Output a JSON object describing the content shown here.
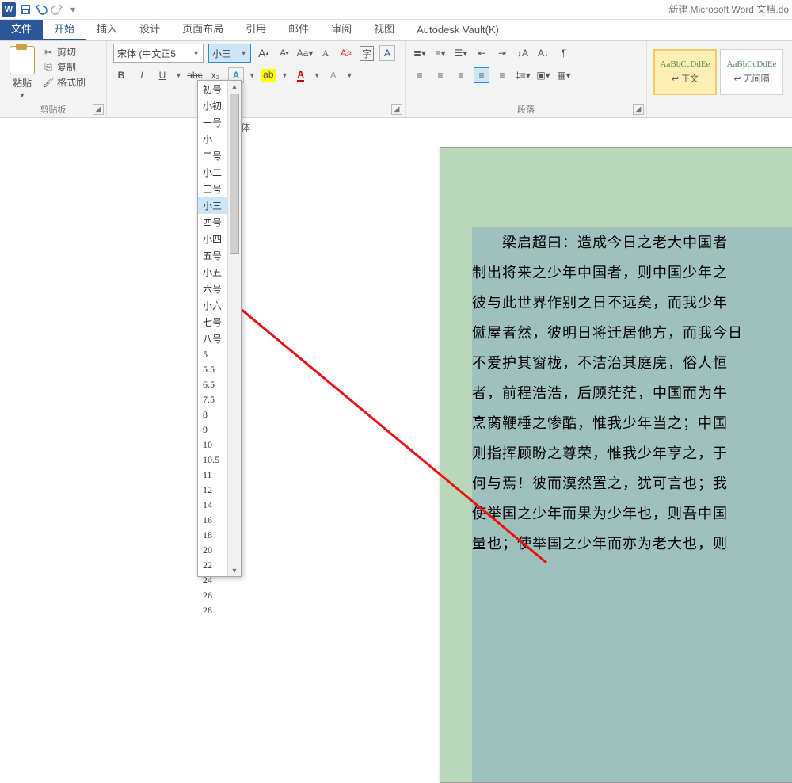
{
  "title": "新建 Microsoft Word 文档.do",
  "qat": {
    "save": "save",
    "undo": "undo",
    "redo": "redo"
  },
  "tabs": {
    "file": "文件",
    "home": "开始",
    "insert": "插入",
    "design": "设计",
    "layout": "页面布局",
    "references": "引用",
    "mailings": "邮件",
    "review": "审阅",
    "view": "视图",
    "vault": "Autodesk Vault(K)"
  },
  "clipboard": {
    "paste": "粘贴",
    "cut": "剪切",
    "copy": "复制",
    "painter": "格式刷",
    "label": "剪贴板"
  },
  "font": {
    "name": "宋体 (中文正5",
    "size": "小三",
    "label_trunc": "体",
    "row_icons": [
      "B",
      "I",
      "U",
      "abc",
      "x₂"
    ]
  },
  "size_list": [
    "初号",
    "小初",
    "一号",
    "小一",
    "二号",
    "小二",
    "三号",
    "小三",
    "四号",
    "小四",
    "五号",
    "小五",
    "六号",
    "小六",
    "七号",
    "八号",
    "5",
    "5.5",
    "6.5",
    "7.5",
    "8",
    "9",
    "10",
    "10.5",
    "11",
    "12",
    "14",
    "16",
    "18",
    "20",
    "22",
    "24",
    "26",
    "28"
  ],
  "size_selected": "小三",
  "paragraph": {
    "label": "段落"
  },
  "styles": {
    "s1": {
      "preview": "AaBbCcDdEe",
      "name": "↩ 正文"
    },
    "s2": {
      "preview": "AaBbCcDdEe",
      "name": "↩ 无间隔"
    }
  },
  "doc_lines": [
    "　　梁启超曰：造成今日之老大中国者",
    "制出将来之少年中国者，则中国少年之",
    "彼与此世界作别之日不远矣，而我少年",
    "僦屋者然，彼明日将迁居他方，而我今日",
    "不爱护其窗栊，不洁治其庭庑，俗人恒",
    "者，前程浩浩，后顾茫茫，中国而为牛",
    "烹脔鞭棰之惨酷，惟我少年当之；中国",
    "则指挥顾盼之尊荣，惟我少年享之，于",
    "何与焉！彼而漠然置之，犹可言也；我",
    "使举国之少年而果为少年也，则吾中国",
    "量也；使举国之少年而亦为老大也，则"
  ]
}
